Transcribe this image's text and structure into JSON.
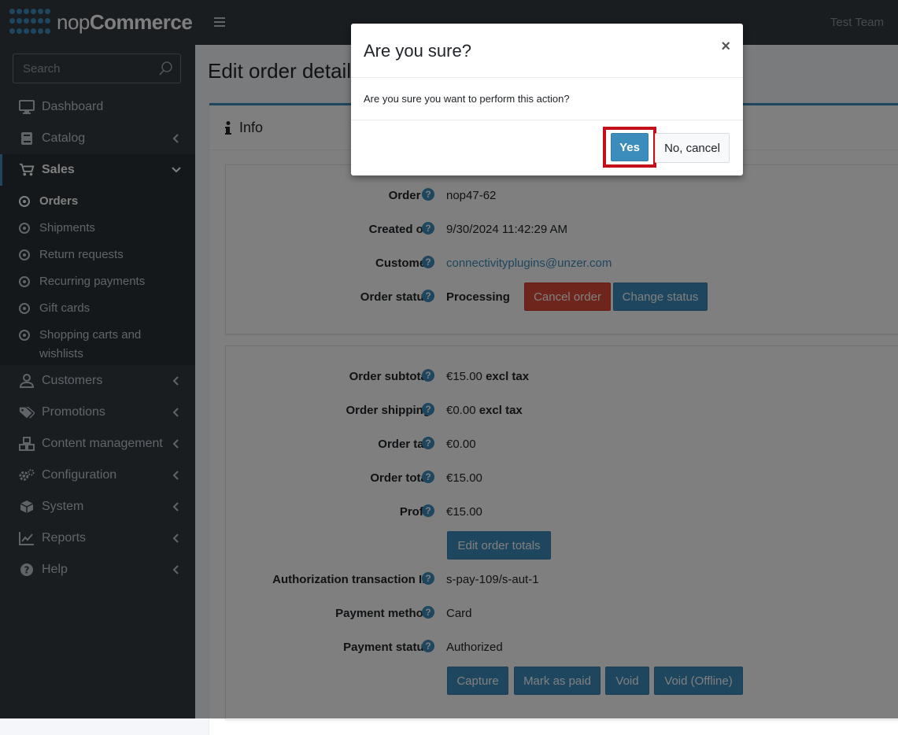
{
  "brand": {
    "name_light": "nop",
    "name_bold": "Commerce"
  },
  "header": {
    "user": "Test Team"
  },
  "search": {
    "placeholder": "Search"
  },
  "sidebar": {
    "items": [
      {
        "label": "Dashboard",
        "icon": "monitor-icon"
      },
      {
        "label": "Catalog",
        "icon": "book-icon"
      },
      {
        "label": "Sales",
        "icon": "cart-icon"
      },
      {
        "label": "Customers",
        "icon": "user-icon"
      },
      {
        "label": "Promotions",
        "icon": "tags-icon"
      },
      {
        "label": "Content management",
        "icon": "cubes-icon"
      },
      {
        "label": "Configuration",
        "icon": "gears-icon"
      },
      {
        "label": "System",
        "icon": "cube-icon"
      },
      {
        "label": "Reports",
        "icon": "chart-icon"
      },
      {
        "label": "Help",
        "icon": "question-icon"
      }
    ],
    "sales_sub": [
      {
        "label": "Orders"
      },
      {
        "label": "Shipments"
      },
      {
        "label": "Return requests"
      },
      {
        "label": "Recurring payments"
      },
      {
        "label": "Gift cards"
      },
      {
        "label": "Shopping carts and wishlists"
      }
    ]
  },
  "page": {
    "title": "Edit order details"
  },
  "card": {
    "title": "Info"
  },
  "order": {
    "number_label": "Order #",
    "number": "nop47-62",
    "created_label": "Created on",
    "created": "9/30/2024 11:42:29 AM",
    "customer_label": "Customer",
    "customer": "connectivityplugins@unzer.com",
    "status_label": "Order status",
    "status": "Processing",
    "cancel_btn": "Cancel order",
    "change_status_btn": "Change status"
  },
  "totals": {
    "subtotal_label": "Order subtotal",
    "subtotal": "€15.00",
    "subtotal_suffix": "excl tax",
    "shipping_label": "Order shipping",
    "shipping": "€0.00",
    "shipping_suffix": "excl tax",
    "tax_label": "Order tax",
    "tax": "€0.00",
    "total_label": "Order total",
    "total": "€15.00",
    "profit_label": "Profit",
    "profit": "€15.00",
    "edit_btn": "Edit order totals",
    "auth_label": "Authorization transaction ID",
    "auth": "s-pay-109/s-aut-1",
    "method_label": "Payment method",
    "method": "Card",
    "pstatus_label": "Payment status",
    "pstatus": "Authorized",
    "capture_btn": "Capture",
    "markpaid_btn": "Mark as paid",
    "void_btn": "Void",
    "voidoff_btn": "Void (Offline)"
  },
  "modal": {
    "title": "Are you sure?",
    "close": "×",
    "body": "Are you sure you want to perform this action?",
    "yes": "Yes",
    "no": "No, cancel"
  },
  "colors": {
    "accent": "#3c8dbc",
    "danger": "#dd4b39",
    "highlight": "#c3101a",
    "sidebar_bg": "#343a40"
  }
}
